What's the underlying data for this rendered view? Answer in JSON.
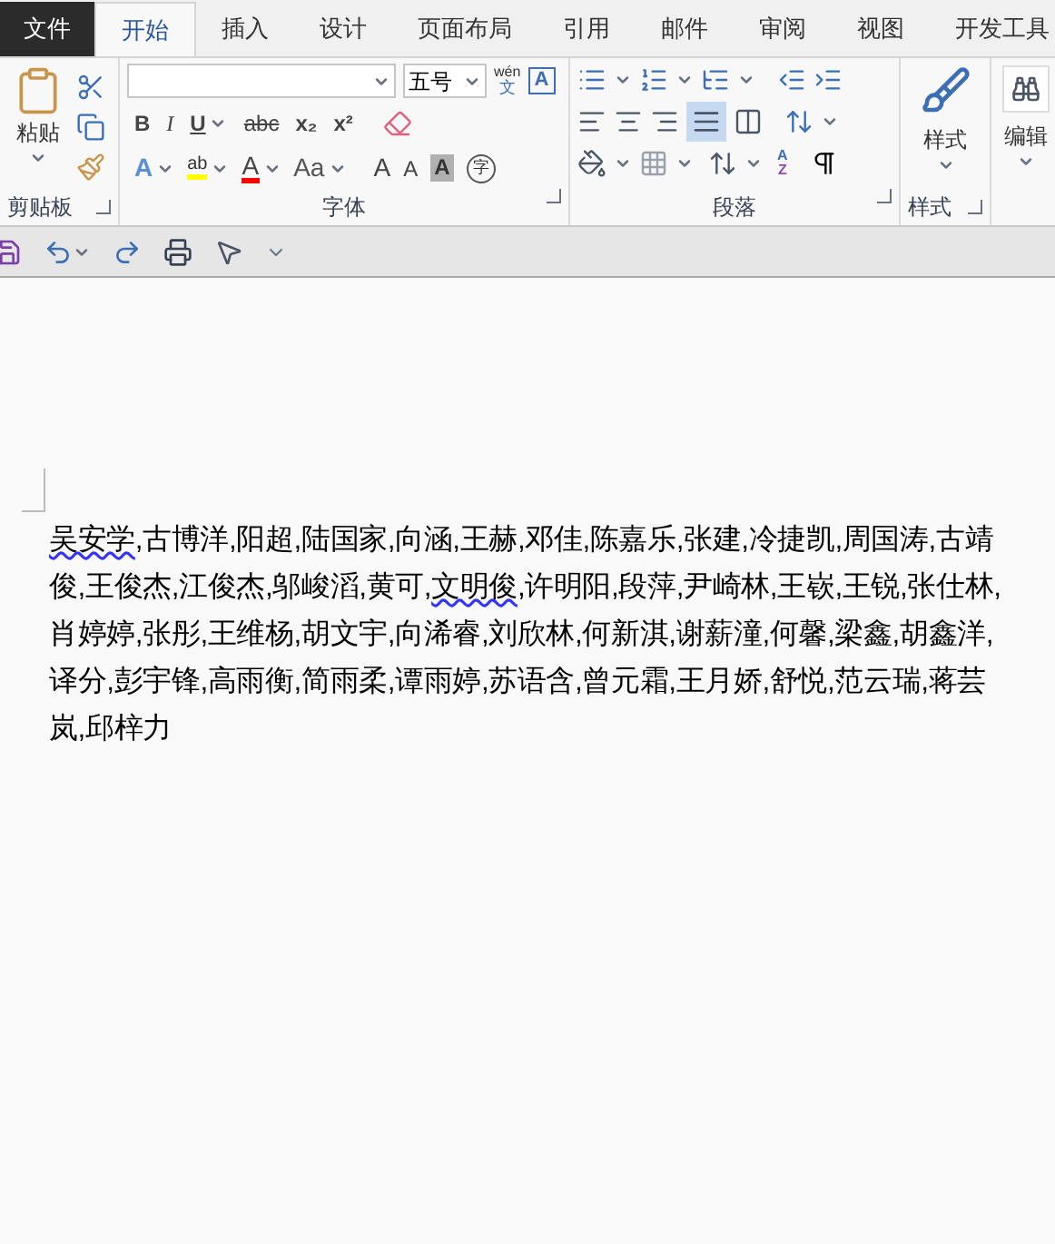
{
  "tabs": [
    {
      "label": "文件",
      "kind": "file",
      "selected": false
    },
    {
      "label": "开始",
      "kind": "tab",
      "selected": true
    },
    {
      "label": "插入",
      "kind": "tab",
      "selected": false
    },
    {
      "label": "设计",
      "kind": "tab",
      "selected": false
    },
    {
      "label": "页面布局",
      "kind": "tab",
      "selected": false
    },
    {
      "label": "引用",
      "kind": "tab",
      "selected": false
    },
    {
      "label": "邮件",
      "kind": "tab",
      "selected": false
    },
    {
      "label": "审阅",
      "kind": "tab",
      "selected": false
    },
    {
      "label": "视图",
      "kind": "tab",
      "selected": false
    },
    {
      "label": "开发工具",
      "kind": "tab",
      "selected": false
    }
  ],
  "clipboard": {
    "paste_label": "粘贴",
    "group_label": "剪贴板"
  },
  "font": {
    "size": "五号",
    "phonetic_top": "wén",
    "phonetic_bottom": "文",
    "buttons": [
      "B",
      "I",
      "U",
      "abc",
      "x₂",
      "x²"
    ],
    "grow": "A",
    "shrink": "A",
    "case": "Aa",
    "shade": "A",
    "border_char": "A",
    "enclose": "字",
    "effect": "A",
    "highlight": "ab",
    "color_letter": "A",
    "group_label": "字体"
  },
  "paragraph": {
    "justify_selected": true,
    "sort_top": "A",
    "sort_bottom": "Z",
    "group_label": "段落"
  },
  "styles": {
    "label": "样式",
    "group_label": "样式"
  },
  "editing": {
    "label": "编辑"
  },
  "document": {
    "lines": [
      [
        {
          "text": "吴安学",
          "flagged": true
        },
        {
          "text": ",古博洋,阳超,陆国家,向涵,王赫,邓佳,陈嘉乐,张建,冷捷凯,周国涛,古靖",
          "flagged": false
        }
      ],
      [
        {
          "text": "俊,王俊杰,江俊杰,邬峻滔,黄可,",
          "flagged": false
        },
        {
          "text": "文明俊",
          "flagged": true
        },
        {
          "text": ",许明阳,段萍,尹崎林,王嵚,王锐,张仕林,",
          "flagged": false
        }
      ],
      [
        {
          "text": "肖婷婷,张彤,王维杨,胡文宇,向浠睿,刘欣林,何新淇,谢薪潼,何馨,梁鑫,胡鑫洋,",
          "flagged": false
        }
      ],
      [
        {
          "text": "译分,彭宇锋,高雨衡,简雨柔,谭雨婷,苏语含,曾元霜,王月娇,舒悦,范云瑞,蒋芸",
          "flagged": false
        }
      ],
      [
        {
          "text": "岚,邱梓力",
          "flagged": false
        }
      ]
    ]
  }
}
